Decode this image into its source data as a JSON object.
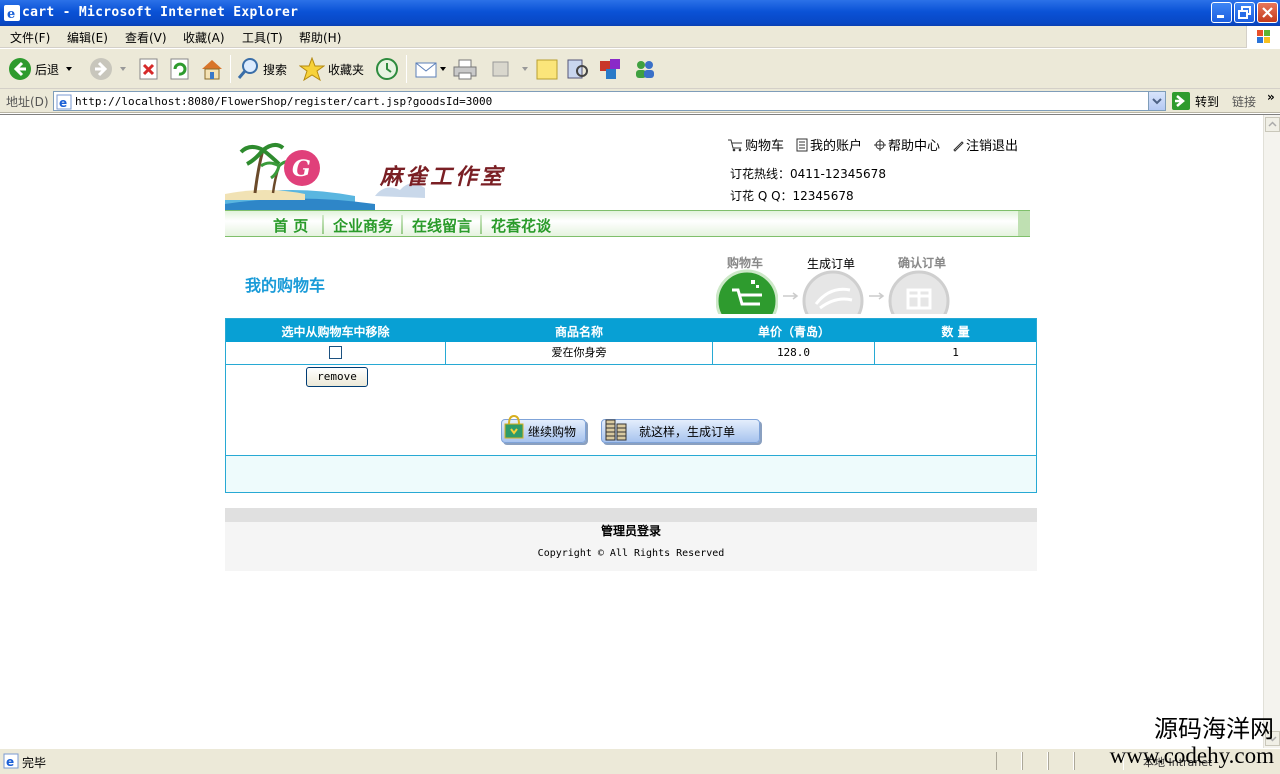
{
  "window": {
    "title": "cart - Microsoft Internet Explorer"
  },
  "menu": [
    "文件(F)",
    "编辑(E)",
    "查看(V)",
    "收藏(A)",
    "工具(T)",
    "帮助(H)"
  ],
  "toolbar": {
    "back": "后退",
    "search": "搜索",
    "favorites": "收藏夹"
  },
  "address": {
    "label": "地址(D)",
    "url": "http://localhost:8080/FlowerShop/register/cart.jsp?goodsId=3000",
    "go": "转到",
    "links": "链接"
  },
  "header": {
    "logo_text": "麻雀工作室",
    "links": [
      "购物车",
      "我的账户",
      "帮助中心",
      "注销退出"
    ],
    "hotline": "订花热线：0411-12345678",
    "qq": "订花 Q Q：12345678"
  },
  "nav": [
    "首 页",
    "企业商务",
    "在线留言",
    "花香花谈"
  ],
  "cart": {
    "title": "我的购物车",
    "steps": [
      "购物车",
      "生成订单",
      "确认订单"
    ],
    "columns": [
      "选中从购物车中移除",
      "商品名称",
      "单价（青岛）",
      "数 量"
    ],
    "rows": [
      {
        "name": "爱在你身旁",
        "price": "128.0",
        "qty": "1"
      }
    ],
    "remove_label": "remove",
    "continue_label": "继续购物",
    "checkout_label": "就这样，生成订单"
  },
  "footer": {
    "admin_login": "管理员登录",
    "copyright": "Copyright © All Rights Reserved"
  },
  "status": {
    "text": "完毕",
    "zone": "本地 Intranet"
  },
  "watermark": {
    "cn": "源码海洋网",
    "en": "www.codehy.com"
  },
  "colors": {
    "accent": "#08a0d4",
    "nav_green": "#2a9b2a",
    "title_bar": "#0a52d6"
  }
}
